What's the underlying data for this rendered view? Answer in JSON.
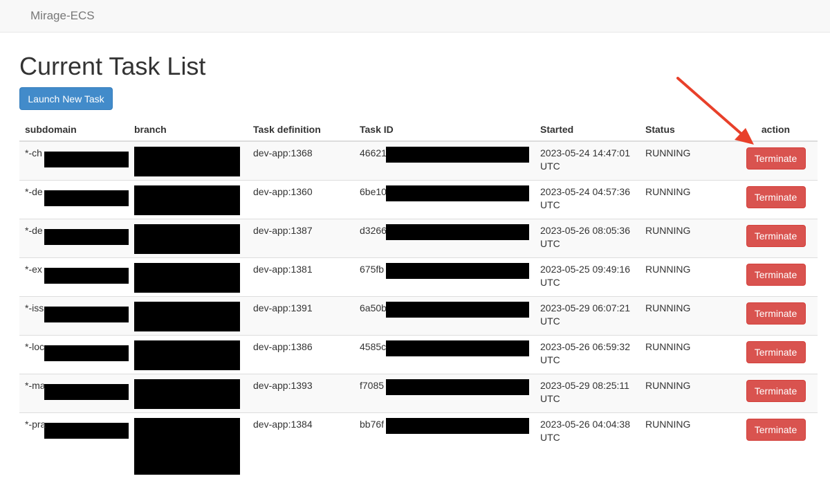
{
  "navbar": {
    "brand": "Mirage-ECS"
  },
  "page": {
    "title": "Current Task List",
    "launch_label": "Launch New Task"
  },
  "table": {
    "headers": {
      "subdomain": "subdomain",
      "branch": "branch",
      "task_definition": "Task definition",
      "task_id": "Task ID",
      "started": "Started",
      "status": "Status",
      "action": "action"
    },
    "rows": [
      {
        "subdomain": "*-ch",
        "task_definition": "dev-app:1368",
        "task_id": "46621",
        "started_date": "2023-05-24 14:47:01",
        "started_tz": "UTC",
        "status": "RUNNING",
        "action": "Terminate"
      },
      {
        "subdomain": "*-de",
        "task_definition": "dev-app:1360",
        "task_id": "6be10",
        "started_date": "2023-05-24 04:57:36",
        "started_tz": "UTC",
        "status": "RUNNING",
        "action": "Terminate"
      },
      {
        "subdomain": "*-de",
        "task_definition": "dev-app:1387",
        "task_id": "d3266",
        "started_date": "2023-05-26 08:05:36",
        "started_tz": "UTC",
        "status": "RUNNING",
        "action": "Terminate"
      },
      {
        "subdomain": "*-ex",
        "task_definition": "dev-app:1381",
        "task_id": "675fb",
        "started_date": "2023-05-25 09:49:16",
        "started_tz": "UTC",
        "status": "RUNNING",
        "action": "Terminate"
      },
      {
        "subdomain": "*-iss",
        "task_definition": "dev-app:1391",
        "task_id": "6a50b",
        "started_date": "2023-05-29 06:07:21",
        "started_tz": "UTC",
        "status": "RUNNING",
        "action": "Terminate"
      },
      {
        "subdomain": "*-loc",
        "task_definition": "dev-app:1386",
        "task_id": "4585c",
        "started_date": "2023-05-26 06:59:32",
        "started_tz": "UTC",
        "status": "RUNNING",
        "action": "Terminate"
      },
      {
        "subdomain": "*-ma",
        "task_definition": "dev-app:1393",
        "task_id": "f7085",
        "started_date": "2023-05-29 08:25:11",
        "started_tz": "UTC",
        "status": "RUNNING",
        "action": "Terminate"
      },
      {
        "subdomain": "*-pra",
        "task_definition": "dev-app:1384",
        "task_id": "bb76f",
        "started_date": "2023-05-26 04:04:38",
        "started_tz": "UTC",
        "status": "RUNNING",
        "action": "Terminate"
      }
    ]
  },
  "annotation": {
    "arrow_color": "#e8402a"
  },
  "colors": {
    "primary": "#428bca",
    "danger": "#d9534f",
    "redaction": "#000000"
  }
}
